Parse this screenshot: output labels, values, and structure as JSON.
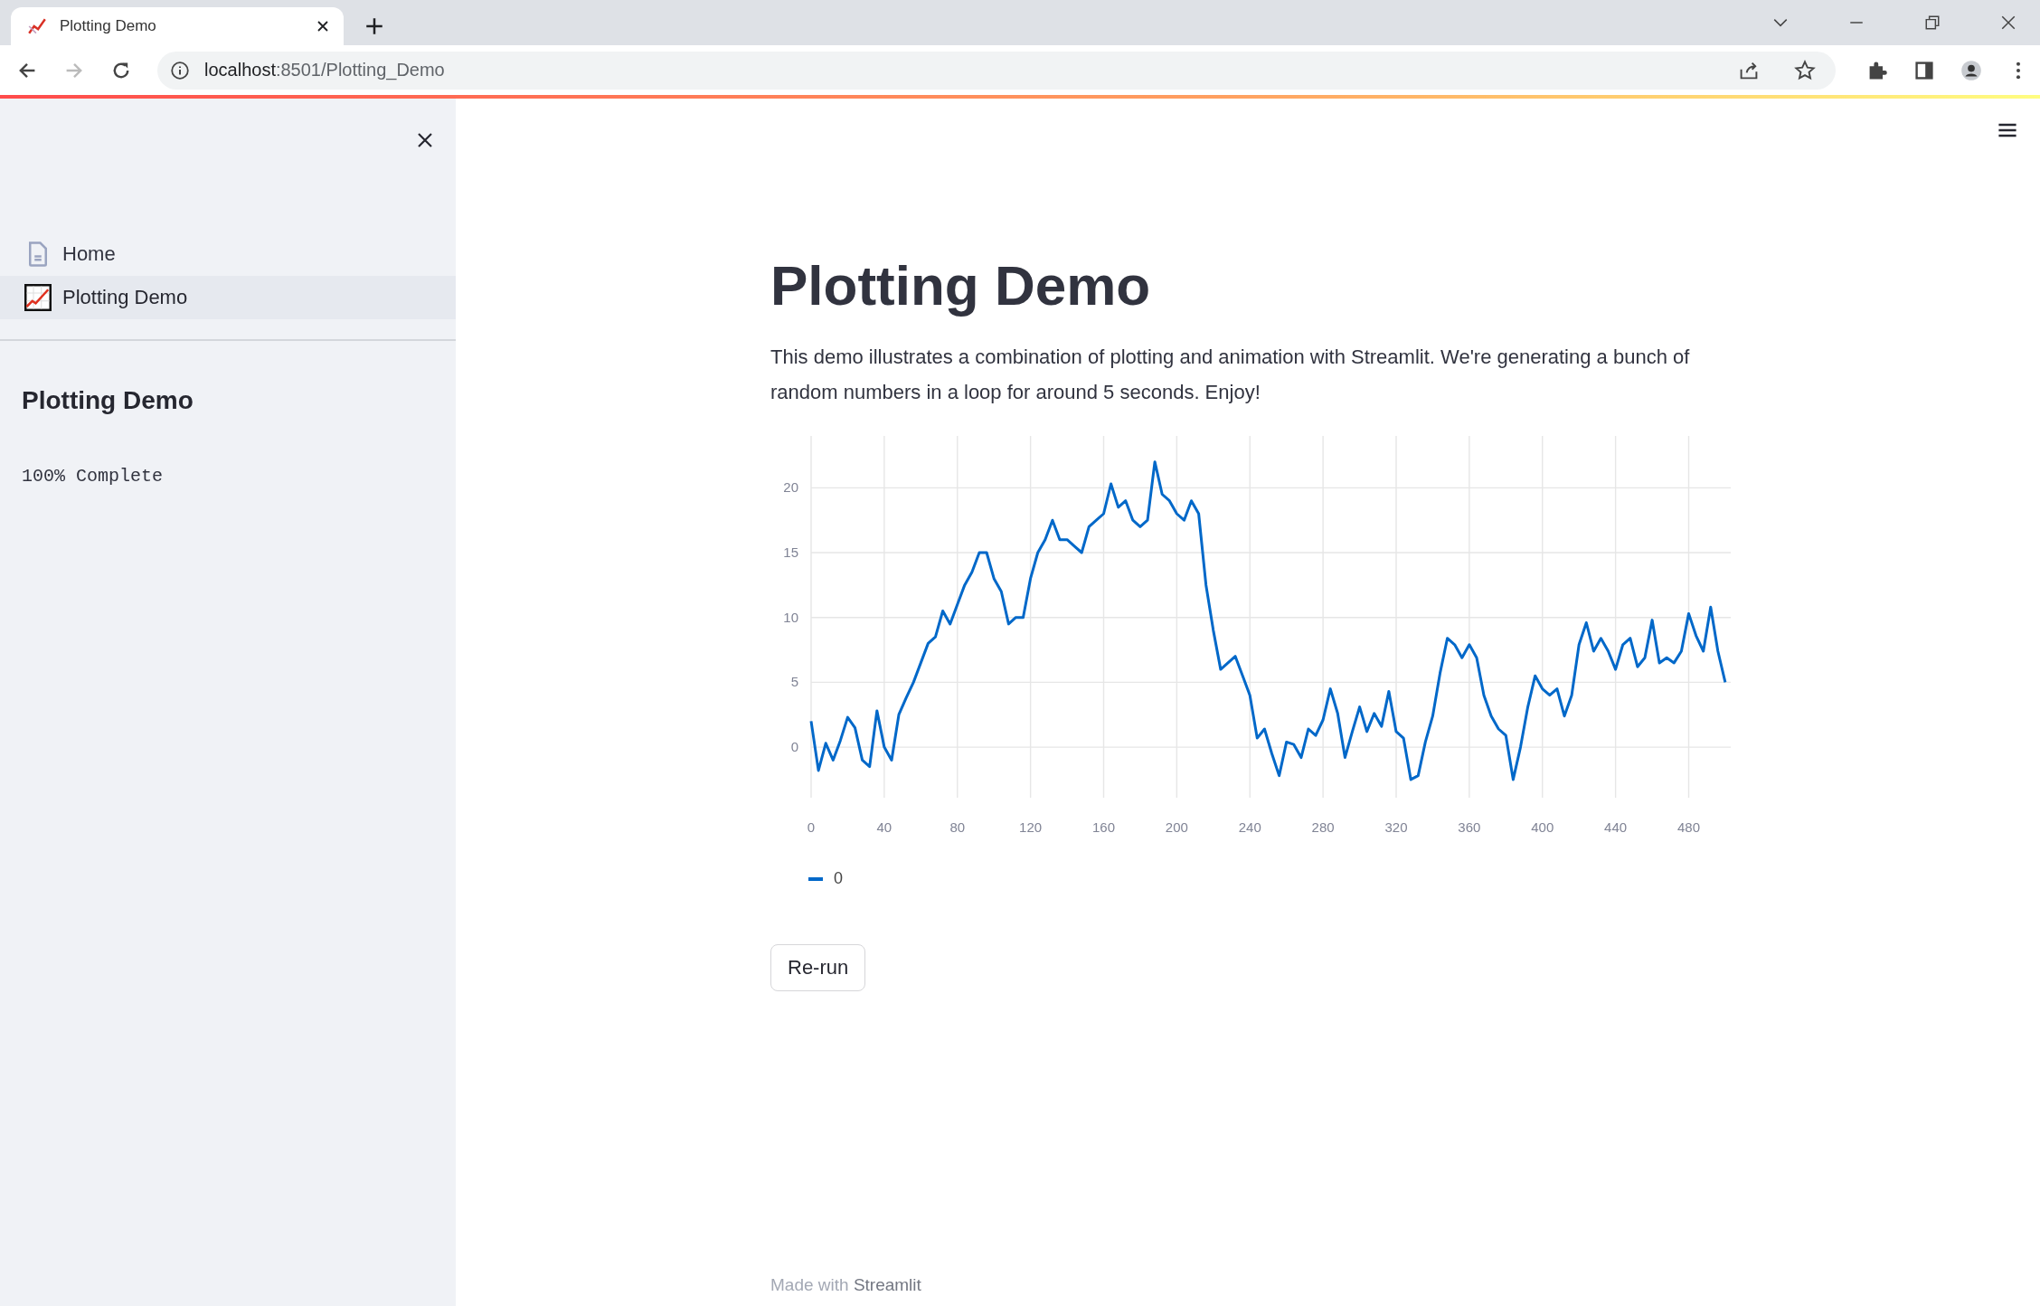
{
  "browser": {
    "tab": {
      "title": "Plotting Demo"
    },
    "url": {
      "host": "localhost",
      "rest": ":8501/Plotting_Demo"
    }
  },
  "sidebar": {
    "nav": [
      {
        "label": "Home",
        "kind": "page",
        "selected": false
      },
      {
        "label": "Plotting Demo",
        "kind": "chart",
        "selected": true
      }
    ],
    "heading": "Plotting Demo",
    "progress_text": "100% Complete"
  },
  "main": {
    "title": "Plotting Demo",
    "description": "This demo illustrates a combination of plotting and animation with Streamlit. We're generating a bunch of random numbers in a loop for around 5 seconds. Enjoy!",
    "chart_data": {
      "type": "line",
      "x": [
        0,
        4,
        8,
        12,
        16,
        20,
        24,
        28,
        32,
        36,
        40,
        44,
        48,
        52,
        56,
        60,
        64,
        68,
        72,
        76,
        80,
        84,
        88,
        92,
        96,
        100,
        104,
        108,
        112,
        116,
        120,
        124,
        128,
        132,
        136,
        140,
        144,
        148,
        152,
        156,
        160,
        164,
        168,
        172,
        176,
        180,
        184,
        188,
        192,
        196,
        200,
        204,
        208,
        212,
        216,
        220,
        224,
        228,
        232,
        236,
        240,
        244,
        248,
        252,
        256,
        260,
        264,
        268,
        272,
        276,
        280,
        284,
        288,
        292,
        296,
        300,
        304,
        308,
        312,
        316,
        320,
        324,
        328,
        332,
        336,
        340,
        344,
        348,
        352,
        356,
        360,
        364,
        368,
        372,
        376,
        380,
        384,
        388,
        392,
        396,
        400,
        404,
        408,
        412,
        416,
        420,
        424,
        428,
        432,
        436,
        440,
        444,
        448,
        452,
        456,
        460,
        464,
        468,
        472,
        476,
        480,
        484,
        488,
        492,
        496,
        500
      ],
      "series": [
        {
          "name": "0",
          "color": "#0068c9",
          "values": [
            2,
            -1.8,
            0.3,
            -1,
            0.5,
            2.3,
            1.5,
            -1,
            -1.5,
            2.8,
            0,
            -1,
            2.5,
            3.8,
            5,
            6.5,
            8,
            8.5,
            10.5,
            9.5,
            11,
            12.5,
            13.5,
            15,
            15,
            13,
            12,
            9.5,
            10,
            10,
            13,
            15,
            16,
            17.5,
            16,
            16,
            15.5,
            15,
            17,
            17.5,
            18,
            20.3,
            18.5,
            19,
            17.5,
            17,
            17.5,
            22,
            19.5,
            19,
            18,
            17.5,
            19,
            18,
            12.5,
            9,
            6,
            6.5,
            7,
            5.5,
            4,
            0.7,
            1.4,
            -0.5,
            -2.2,
            0.4,
            0.2,
            -0.8,
            1.4,
            0.9,
            2.1,
            4.5,
            2.6,
            -0.8,
            1.2,
            3.1,
            1.2,
            2.6,
            1.6,
            4.3,
            1.2,
            0.7,
            -2.5,
            -2.2,
            0.4,
            2.4,
            5.7,
            8.4,
            7.9,
            6.9,
            7.9,
            6.9,
            4,
            2.4,
            1.4,
            0.9,
            -2.5,
            0,
            3.1,
            5.5,
            4.5,
            4,
            4.5,
            2.4,
            4,
            7.9,
            9.6,
            7.4,
            8.4,
            7.4,
            6,
            7.9,
            8.4,
            6.2,
            6.9,
            9.8,
            6.5,
            6.9,
            6.5,
            7.4,
            10.3,
            8.6,
            7.4,
            10.8,
            7.4,
            5
          ]
        }
      ],
      "grid": true,
      "xlim": [
        0,
        503
      ],
      "ylim": [
        -3.9,
        24
      ],
      "xticks": [
        0,
        40,
        80,
        120,
        160,
        200,
        240,
        280,
        320,
        360,
        400,
        440,
        480
      ],
      "yticks": [
        0,
        5,
        10,
        15,
        20
      ]
    },
    "button": "Re-run",
    "footer": {
      "prefix": "Made with",
      "link": "Streamlit"
    }
  }
}
